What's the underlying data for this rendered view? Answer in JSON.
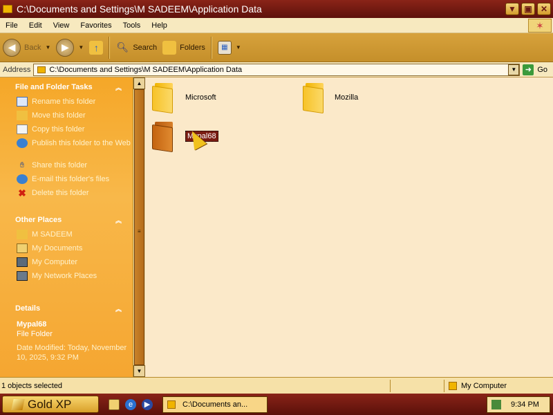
{
  "window": {
    "title": "C:\\Documents and Settings\\M SADEEM\\Application Data"
  },
  "menu": [
    "File",
    "Edit",
    "View",
    "Favorites",
    "Tools",
    "Help"
  ],
  "toolbar": {
    "back": "Back",
    "search": "Search",
    "folders": "Folders"
  },
  "address": {
    "label": "Address",
    "value": "C:\\Documents and Settings\\M SADEEM\\Application Data",
    "go": "Go"
  },
  "tasks": {
    "title": "File and Folder Tasks",
    "items": [
      "Rename this folder",
      "Move this folder",
      "Copy this folder",
      "Publish this folder to the Web",
      "Share this folder",
      "E-mail this folder's files",
      "Delete this folder"
    ]
  },
  "other_places": {
    "title": "Other Places",
    "items": [
      "M SADEEM",
      "My Documents",
      "My Computer",
      "My Network Places"
    ]
  },
  "details": {
    "title": "Details",
    "name": "Mypal68",
    "type": "File Folder",
    "modified": "Date Modified: Today, November 10, 2025, 9:32 PM"
  },
  "folders": [
    {
      "name": "Microsoft"
    },
    {
      "name": "Mozilla"
    },
    {
      "name": "Mypal68",
      "selected": true
    }
  ],
  "status": {
    "selection": "1 objects selected",
    "location": "My Computer"
  },
  "taskbar": {
    "start": "Gold XP",
    "task": "C:\\Documents an...",
    "clock": "9:34 PM"
  },
  "colors": {
    "title_bar": "#6b1a14",
    "task_pane": "#f5a728",
    "content_bg": "#fbe9c9",
    "selection": "#7a1d12"
  }
}
